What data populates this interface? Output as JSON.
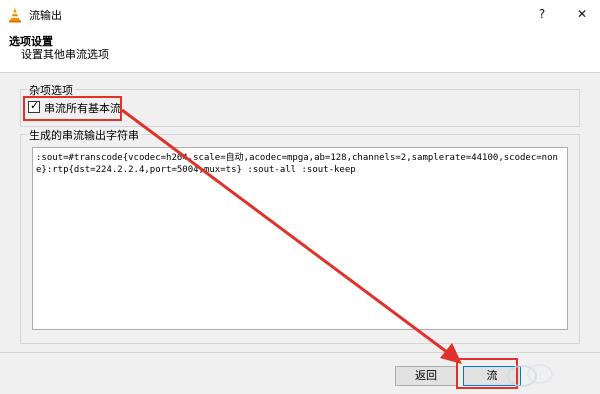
{
  "window": {
    "title": "流输出",
    "help_label": "?",
    "close_label": "✕"
  },
  "header": {
    "heading": "选项设置",
    "subheading": "设置其他串流选项"
  },
  "misc_group": {
    "legend": "杂项选项",
    "checkbox_label": "串流所有基本流",
    "checked": true
  },
  "output_group": {
    "legend": "生成的串流输出字符串",
    "text": ":sout=#transcode{vcodec=h264,scale=自动,acodec=mpga,ab=128,channels=2,samplerate=44100,scodec=none}:rtp{dst=224.2.2.4,port=5004,mux=ts} :sout-all :sout-keep"
  },
  "buttons": {
    "back_label": "返回",
    "stream_label": "流"
  },
  "colors": {
    "annotation": "#e0312a",
    "accent": "#0078d7"
  }
}
